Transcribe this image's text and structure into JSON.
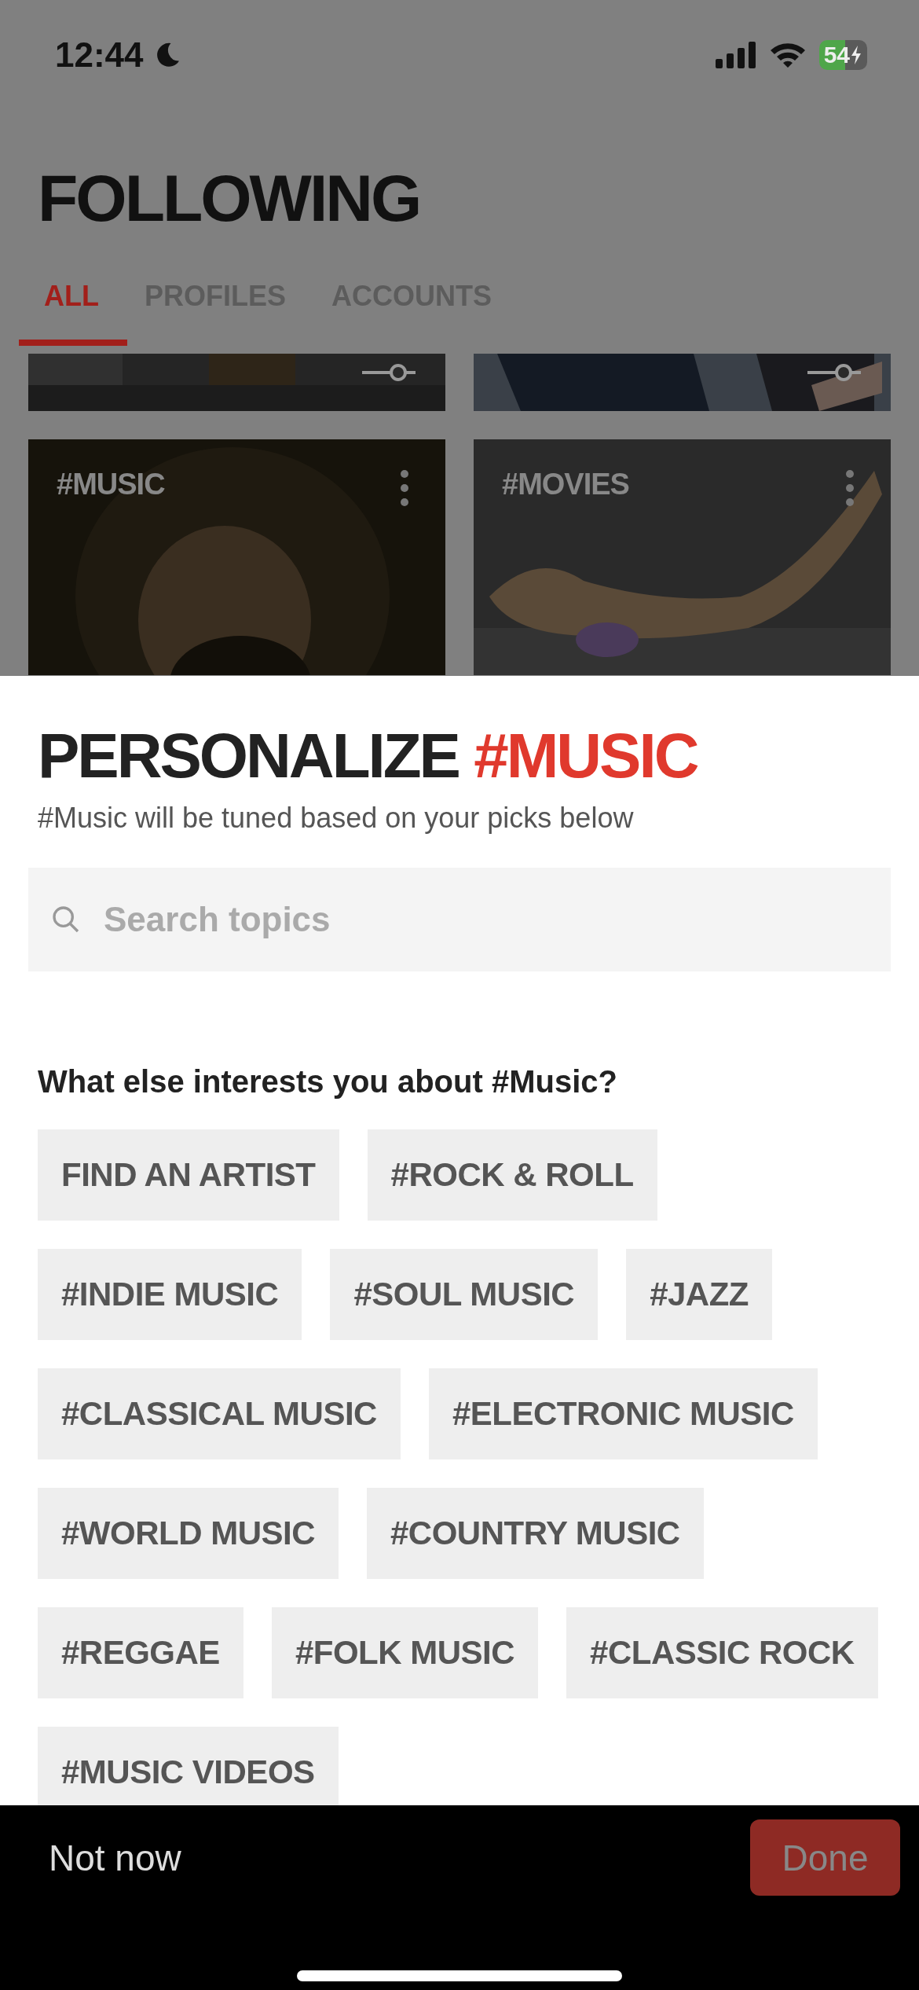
{
  "status_bar": {
    "time": "12:44",
    "battery": "54"
  },
  "header": {
    "title": "FOLLOWING"
  },
  "tabs": [
    {
      "label": "ALL",
      "selected": true
    },
    {
      "label": "PROFILES",
      "selected": false
    },
    {
      "label": "ACCOUNTS",
      "selected": false
    }
  ],
  "cards": [
    {
      "tag": "#MUSIC"
    },
    {
      "tag": "#MOVIES"
    }
  ],
  "sheet": {
    "title": "PERSONALIZE",
    "title_tag": "#MUSIC",
    "subtitle": "#Music will be tuned based on your picks below",
    "search": {
      "placeholder": "Search topics"
    },
    "question": "What else interests you about #Music?",
    "chips": [
      "FIND AN ARTIST",
      "#ROCK & ROLL",
      "#INDIE MUSIC",
      "#SOUL MUSIC",
      "#JAZZ",
      "#CLASSICAL MUSIC",
      "#ELECTRONIC MUSIC",
      "#WORLD MUSIC",
      "#COUNTRY MUSIC",
      "#REGGAE",
      "#FOLK MUSIC",
      "#CLASSIC ROCK",
      "#MUSIC VIDEOS"
    ]
  },
  "bottom_bar": {
    "secondary": "Not now",
    "primary": {
      "label": "Done",
      "disabled": true
    }
  }
}
